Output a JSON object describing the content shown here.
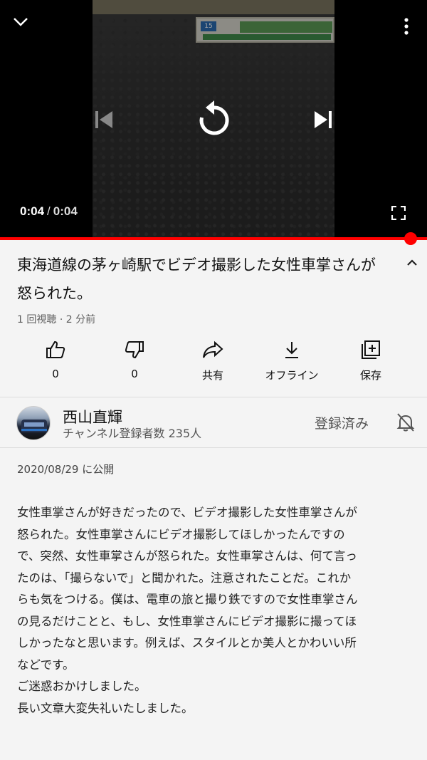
{
  "player": {
    "current_time": "0:04",
    "separator": "/",
    "total_time": "0:04",
    "progress": 1.0,
    "accent_color": "#ff0000",
    "icons": [
      "chevron-down-icon",
      "more-vert-icon",
      "skip-previous-icon",
      "replay-icon",
      "skip-next-icon",
      "fullscreen-icon"
    ]
  },
  "video": {
    "title": "東海道線の茅ヶ崎駅でビデオ撮影した女性車掌さんが怒られた。",
    "views": "1 回視聴",
    "dot": "·",
    "age": "2 分前"
  },
  "actions": [
    {
      "name": "like",
      "label": "0",
      "icon": "thumbs-up-icon"
    },
    {
      "name": "dislike",
      "label": "0",
      "icon": "thumbs-down-icon"
    },
    {
      "name": "share",
      "label": "共有",
      "icon": "share-icon"
    },
    {
      "name": "offline",
      "label": "オフライン",
      "icon": "download-icon"
    },
    {
      "name": "save",
      "label": "保存",
      "icon": "add-to-playlist-icon"
    }
  ],
  "channel": {
    "name": "西山直輝",
    "subscribers": "チャンネル登録者数 235人",
    "subscribe_state": "登録済み",
    "bell_icon": "bell-off-icon"
  },
  "description": {
    "published": "2020/08/29 に公開",
    "lines": [
      "女性車掌さんが好きだったので、ビデオ撮影した女性車掌さんが",
      "怒られた。女性車掌さんにビデオ撮影してほしかったんですの",
      "で、突然、女性車掌さんが怒られた。女性車掌さんは、何て言っ",
      "たのは、「撮らないで」と聞かれた。注意されたことだ。これか",
      "らも気をつける。僕は、電車の旅と撮り鉄ですので女性車掌さん",
      "の見るだけことと、もし、女性車掌さんにビデオ撮影に撮ってほ",
      "しかったなと思います。例えば、スタイルとか美人とかわいい所",
      "などです。",
      "ご迷惑おかけしました。",
      "長い文章大変失礼いたしました。"
    ]
  }
}
